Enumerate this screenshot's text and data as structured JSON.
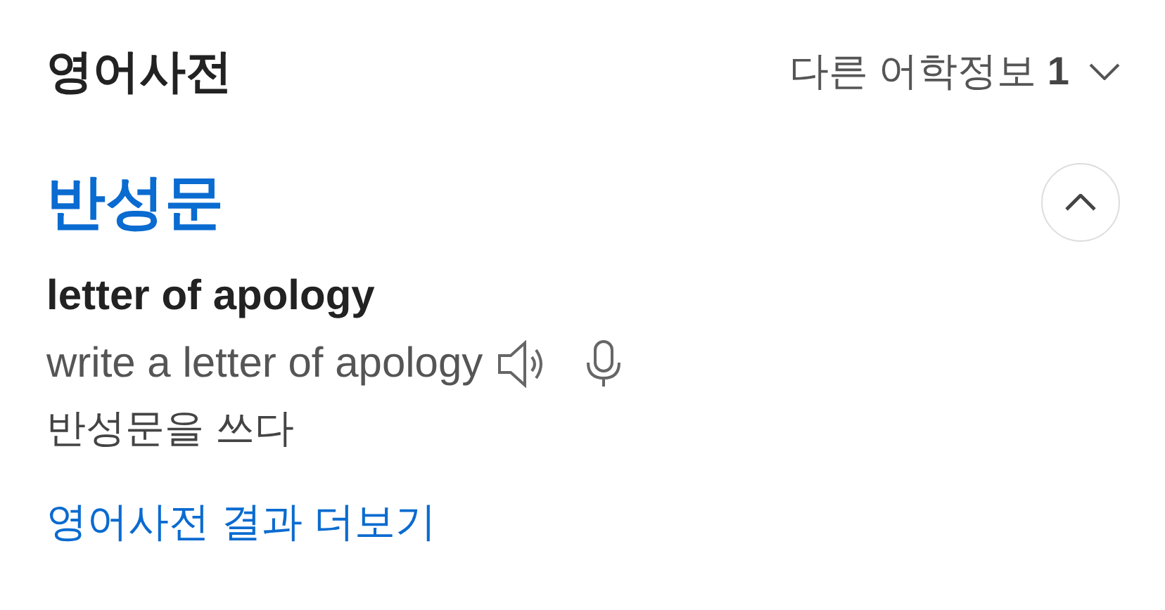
{
  "header": {
    "title": "영어사전",
    "other_info": "다른 어학정보 **1**"
  },
  "entry": {
    "headword": "반성문",
    "expanded": true,
    "meaning": "letter of apology",
    "example": {
      "text": "write a letter of apology",
      "translation": "반성문을 쓰다"
    }
  },
  "more_link": "영어사전 결과 더보기"
}
